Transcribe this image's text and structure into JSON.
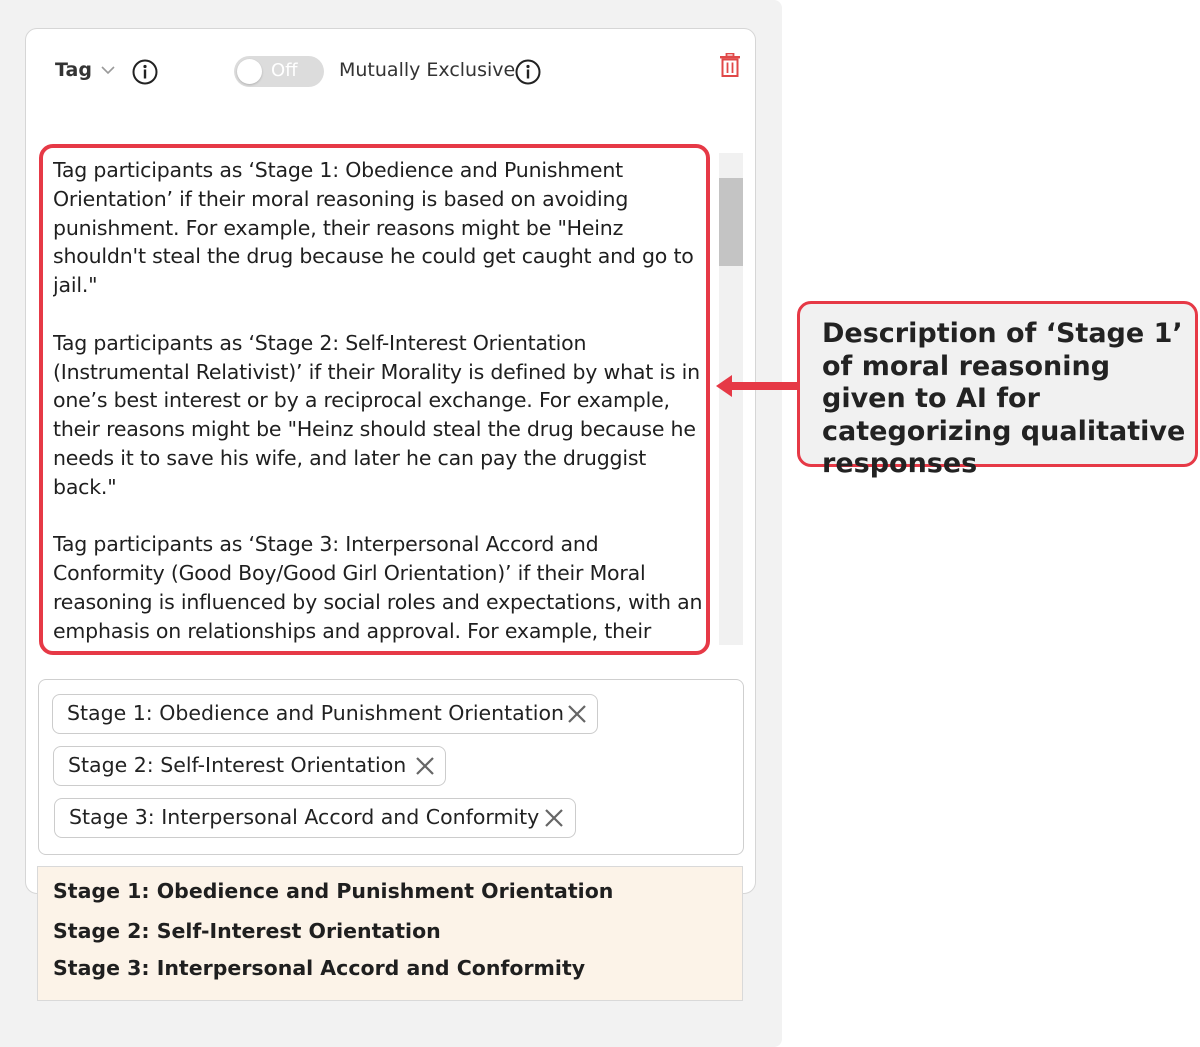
{
  "header": {
    "tag_label": "Tag",
    "toggle_state": "Off",
    "mutually_exclusive_label": "Mutually Exclusive"
  },
  "prompt_text": "Tag participants as ‘Stage 1: Obedience and Punishment Orientation’ if their moral reasoning is based on avoiding punishment. For example, their reasons might be \"Heinz shouldn't steal the drug because he could get caught and go to jail.\"\n\nTag participants as ‘Stage 2: Self-Interest Orientation (Instrumental Relativist)’ if their Morality is defined by what is in one’s best interest or by a reciprocal exchange. For example, their reasons might be \"Heinz should steal the drug because he needs it to save his wife, and later he can pay the druggist back.\"\n\nTag participants as ‘Stage 3: Interpersonal Accord and Conformity (Good Boy/Good Girl Orientation)’ if their Moral reasoning is influenced by social roles and expectations, with an emphasis on relationships and approval. For example, their reasons might be \"Heinz should steal the drug because he loves his wife, and a good.",
  "chips": [
    {
      "label": "Stage 1: Obedience and Punishment Orientation"
    },
    {
      "label": "Stage 2: Self-Interest Orientation"
    },
    {
      "label": "Stage 3: Interpersonal Accord and Conformity"
    }
  ],
  "summary": [
    {
      "label": "Stage 1: Obedience and Punishment Orientation"
    },
    {
      "label": "Stage 2: Self-Interest Orientation"
    },
    {
      "label": "Stage 3: Interpersonal Accord and Conformity"
    }
  ],
  "callout": {
    "text": "Description of ‘Stage 1’ of moral reasoning given to AI for categorizing qualitative responses"
  },
  "icons": {
    "dropdown": "chevron-down-icon",
    "info": "info-icon",
    "delete": "trash-icon",
    "remove_chip": "close-icon",
    "pointer": "arrow-left-icon"
  },
  "colors": {
    "highlight": "#e63946",
    "toggle_off": "#dcdcdc",
    "summary_bg": "#fcf3e8",
    "trash": "#e04848"
  }
}
